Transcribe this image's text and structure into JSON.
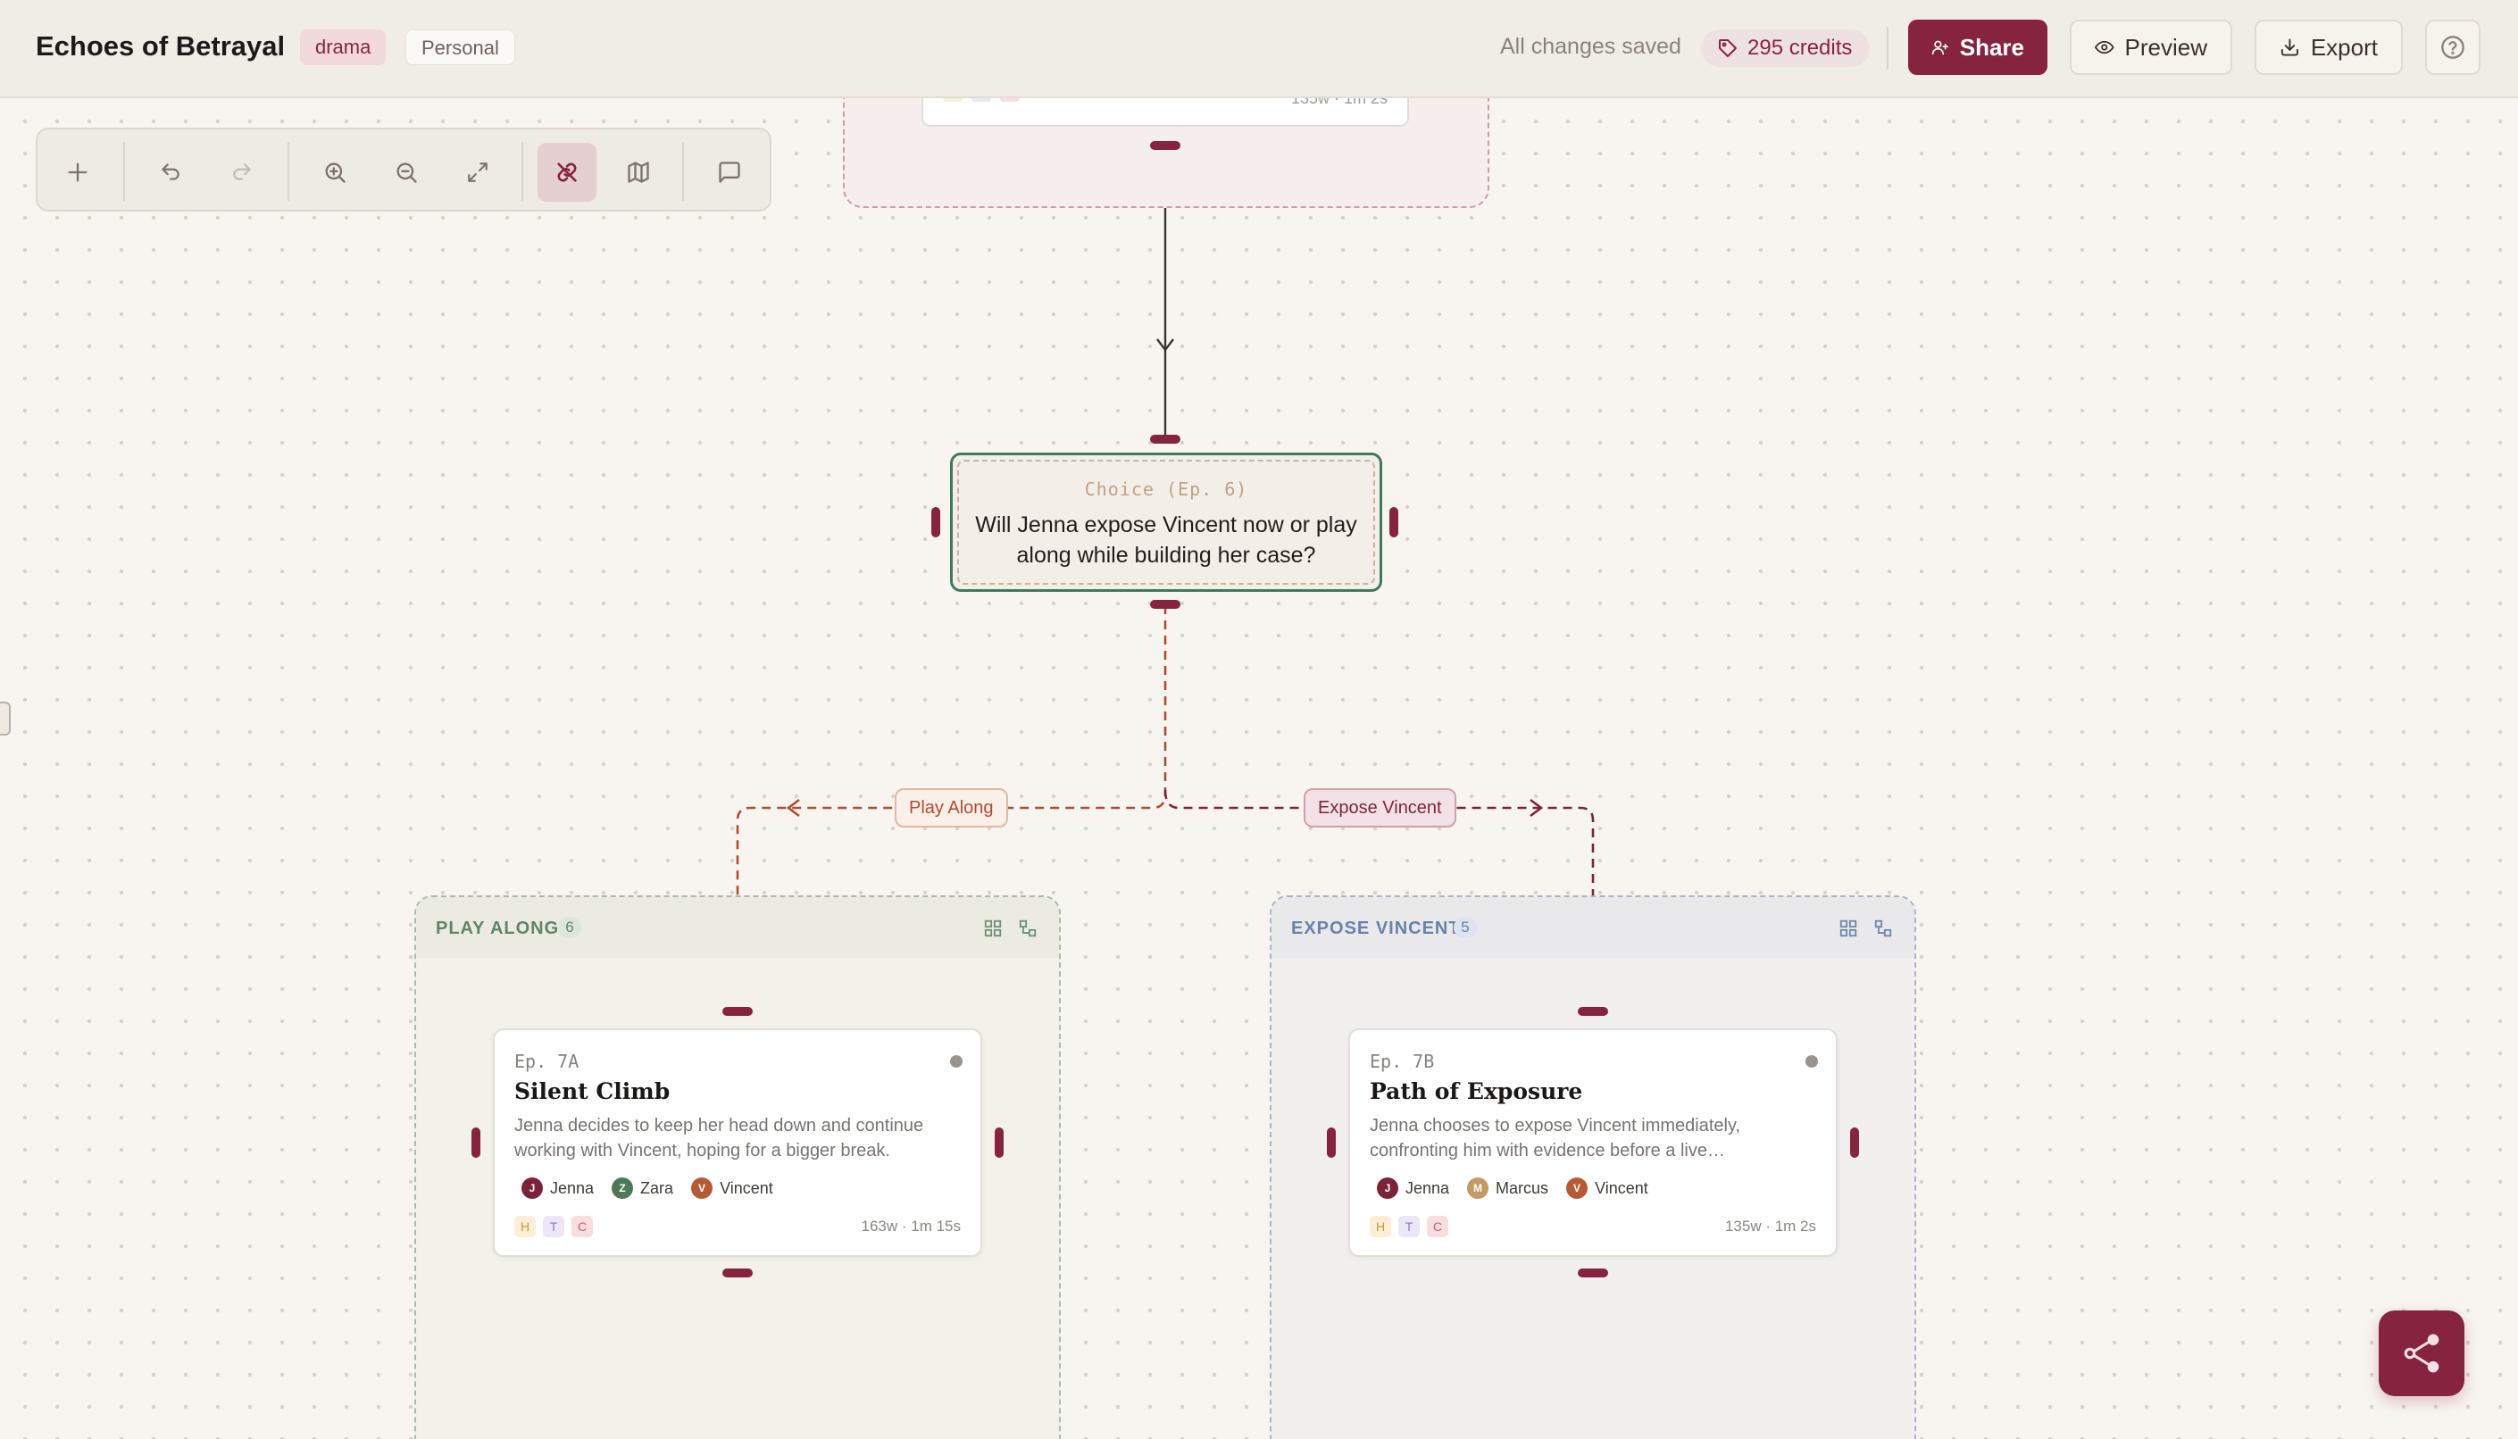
{
  "header": {
    "title": "Echoes of Betrayal",
    "genre_tag": "drama",
    "scope_tag": "Personal",
    "save_status": "All changes saved",
    "credits": "295 credits",
    "share_label": "Share",
    "preview_label": "Preview",
    "export_label": "Export"
  },
  "canvas": {
    "top_card": {
      "meta": "135w · 1m 2s"
    },
    "choice": {
      "label": "Choice (Ep. 6)",
      "question": "Will Jenna expose Vincent now or play along while building her case?"
    },
    "edges": {
      "left": "Play Along",
      "right": "Expose Vincent"
    },
    "groups": [
      {
        "title": "PLAY ALONG",
        "count": "6",
        "episode": {
          "number": "Ep. 7A",
          "title": "Silent Climb",
          "description": "Jenna decides to keep her head down and continue working with Vincent, hoping for a bigger break.",
          "characters": [
            {
              "initial": "J",
              "name": "Jenna",
              "color": "#7a2236"
            },
            {
              "initial": "Z",
              "name": "Zara",
              "color": "#4d7a55"
            },
            {
              "initial": "V",
              "name": "Vincent",
              "color": "#b65a35"
            }
          ],
          "tags": [
            "H",
            "T",
            "C"
          ],
          "meta": "163w · 1m 15s"
        }
      },
      {
        "title": "EXPOSE VINCENT",
        "count": "5",
        "episode": {
          "number": "Ep. 7B",
          "title": "Path of Exposure",
          "description": "Jenna chooses to expose Vincent immediately, confronting him with evidence before a live…",
          "characters": [
            {
              "initial": "J",
              "name": "Jenna",
              "color": "#7a2236"
            },
            {
              "initial": "M",
              "name": "Marcus",
              "color": "#c29a63"
            },
            {
              "initial": "V",
              "name": "Vincent",
              "color": "#b65a35"
            }
          ],
          "tags": [
            "H",
            "T",
            "C"
          ],
          "meta": "135w · 1m 2s"
        }
      }
    ]
  },
  "colors": {
    "accent": "#86233f",
    "choice_border": "#3f7a5c",
    "play_branch": "#b24c2f",
    "expose_branch": "#7e2439"
  }
}
